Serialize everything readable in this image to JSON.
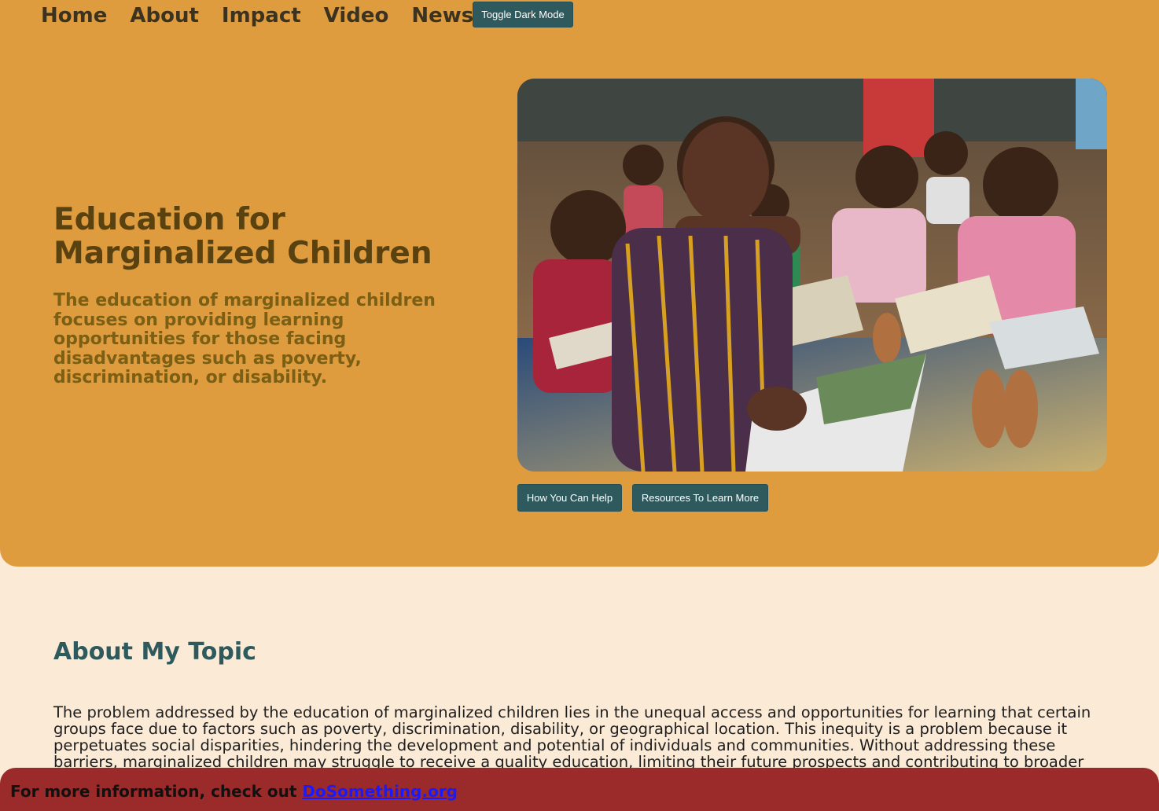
{
  "nav": {
    "items": [
      {
        "label": "Home"
      },
      {
        "label": "About"
      },
      {
        "label": "Impact"
      },
      {
        "label": "Video"
      },
      {
        "label": "News"
      }
    ],
    "toggle_label": "Toggle Dark Mode"
  },
  "hero": {
    "title_line1": "Education for",
    "title_line2": "Marginalized Children",
    "subtitle": "The education of marginalized children focuses on providing learning opportunities for those facing disadvantages such as poverty, discrimination, or disability.",
    "help_button": "How You Can Help",
    "resources_button": "Resources To Learn More"
  },
  "about": {
    "heading": "About My Topic",
    "body": "The problem addressed by the education of marginalized children lies in the unequal access and opportunities for learning that certain groups face due to factors such as poverty, discrimination, disability, or geographical location. This inequity is a problem because it perpetuates social disparities, hindering the development and potential of individuals and communities. Without addressing these barriers, marginalized children may struggle to receive a quality education, limiting their future prospects and contributing to broader"
  },
  "footer": {
    "text": "For more information, check out",
    "link_label": "DoSomething.org"
  },
  "colors": {
    "hero_bg": "#df9c3e",
    "page_bg": "#fbead6",
    "button_bg": "#2e5a5e",
    "footer_bg": "#9b2a2a",
    "link": "#1a1aff"
  }
}
